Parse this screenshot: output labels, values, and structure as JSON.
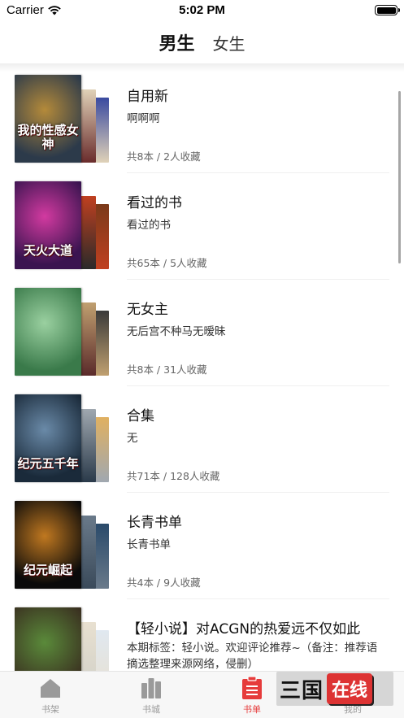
{
  "status_bar": {
    "carrier": "Carrier",
    "time": "5:02 PM"
  },
  "tabs": [
    {
      "label": "男生",
      "active": true
    },
    {
      "label": "女生",
      "active": false
    }
  ],
  "lists": [
    {
      "title": "自用新",
      "description": "啊啊啊",
      "meta": "共8本 / 2人收藏",
      "cover_text": "我的性感女神",
      "cover_colors": [
        "#2c3a4a",
        "#b48a3a",
        "#6a2c2c",
        "#e0d2b8",
        "#3a4aa0"
      ]
    },
    {
      "title": "看过的书",
      "description": "看过的书",
      "meta": "共65本 / 5人收藏",
      "cover_text": "天火大道",
      "cover_colors": [
        "#3a1450",
        "#d23aa0",
        "#2a2a2a",
        "#c04020",
        "#7a3a1a"
      ]
    },
    {
      "title": "无女主",
      "description": "无后宫不种马无暧昧",
      "meta": "共8本 / 31人收藏",
      "cover_text": "",
      "cover_colors": [
        "#3a7a4a",
        "#9ad0a0",
        "#5a2a2a",
        "#c0a070",
        "#3a3a3a"
      ]
    },
    {
      "title": "合集",
      "description": "无",
      "meta": "共71本 / 128人收藏",
      "cover_text": "纪元五千年",
      "cover_colors": [
        "#1a2a3a",
        "#6a8aa8",
        "#2a3a4a",
        "#a0a8b0",
        "#e0b060"
      ]
    },
    {
      "title": "长青书单",
      "description": "长青书单",
      "meta": "共4本 / 9人收藏",
      "cover_text": "纪元崛起",
      "cover_colors": [
        "#0a0a0a",
        "#c07820",
        "#3a4a5a",
        "#6a7a8a",
        "#2a4a6a"
      ]
    },
    {
      "title": "【轻小说】对ACGN的热爱远不仅如此",
      "description": "本期标签：轻小说。欢迎评论推荐~（备注：推荐语摘选整理来源网络，侵删）",
      "meta": "",
      "cover_text": "",
      "cover_colors": [
        "#3a3020",
        "#5a8a3a",
        "#d0d0c8",
        "#e8e0d0",
        "#e0e8f0"
      ]
    }
  ],
  "tab_bar": [
    {
      "label": "书架",
      "icon": "bookshelf-icon",
      "active": false
    },
    {
      "label": "书城",
      "icon": "bookstore-icon",
      "active": false
    },
    {
      "label": "书单",
      "icon": "booklist-icon",
      "active": true
    },
    {
      "label": "我的",
      "icon": "profile-icon",
      "active": false
    }
  ],
  "watermark": {
    "text_a": "三国",
    "text_b": "在线"
  },
  "colors": {
    "accent": "#e63b3b",
    "inactive": "#999999"
  }
}
